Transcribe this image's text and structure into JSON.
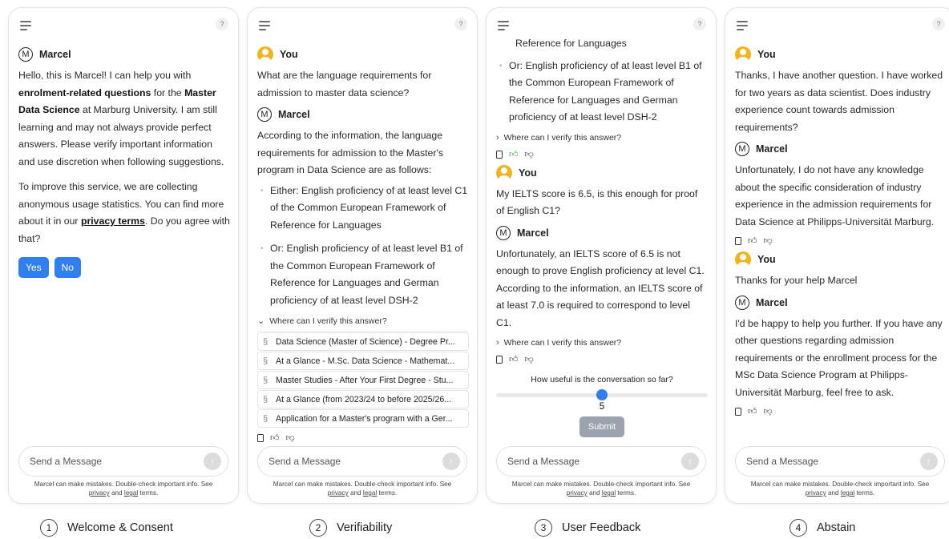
{
  "help_label": "?",
  "input_placeholder": "Send a Message",
  "disclaimer": {
    "text": "Marcel can make mistakes. Double-check important info. See",
    "privacy": "privacy",
    "and": "and",
    "legal": "legal",
    "terms": "terms."
  },
  "names": {
    "bot": "Marcel",
    "user": "You"
  },
  "icons": {
    "menu": "hamburger-icon",
    "send": "arrow-up-icon",
    "copy": "clipboard-icon",
    "like": "thumbs-up-icon",
    "dislike": "thumbs-down-icon",
    "source": "document-icon"
  },
  "colors": {
    "accent": "#2f7ff0",
    "user_avatar": "#f2b31c",
    "like_active": "#22a045",
    "submit_disabled": "#9ba3ae"
  },
  "verify_label": "Where can I verify this answer?",
  "panel1": {
    "msg1_a": "Hello, this is Marcel! I can help you with ",
    "msg1_b": "enrolment-related questions",
    "msg1_c": " for the ",
    "msg1_d": "Master Data Science",
    "msg1_e": " at Marburg University. I am still learning and may not always provide perfect answers. Please verify important information and use discretion when following suggestions.",
    "msg2_a": "To improve this service, we are collecting anonymous usage statistics. You can find more about it in our ",
    "msg2_link": "privacy terms",
    "msg2_b": ". Do you agree with that?",
    "yes": "Yes",
    "no": "No"
  },
  "panel2": {
    "question": "What are the language requirements for admission to master data science?",
    "answer": "According to the information, the language requirements for admission to the Master's program in Data Science are as follows:",
    "bullets": [
      "Either: English proficiency of at least level C1 of the Common European Framework of Reference for Languages",
      "Or: English proficiency of at least level B1 of the Common European Framework of Reference for Languages and German proficiency of at least level DSH-2"
    ],
    "sources": [
      "Data Science (Master of Science) - Degree Pr...",
      "At a Glance - M.Sc. Data Science - Mathemat...",
      "Master Studies - After Your First Degree - Stu...",
      "At a Glance (from 2023/24 to before 2025/26...",
      "Application for a Master's program with a Ger..."
    ]
  },
  "panel3": {
    "bullet_tail": "Reference for Languages",
    "bullet2": "Or: English proficiency of at least level B1 of the Common European Framework of Reference for Languages and German proficiency of at least level DSH-2",
    "question": "My IELTS score is 6.5, is this enough for proof of English C1?",
    "answer": "Unfortunately, an IELTS score of 6.5 is not enough to prove English proficiency at level C1. According to the information, an IELTS score of at least 7.0 is required to correspond to level C1.",
    "feedback_question": "How useful is the conversation so far?",
    "feedback_value": "5",
    "feedback_fraction": 0.5,
    "submit": "Submit"
  },
  "panel4": {
    "q1": "Thanks, I have another question. I have worked for two years as data scientist. Does industry experience count towards admission requirements?",
    "a1": "Unfortunately, I do not have any knowledge about the specific consideration of industry experience in the admission requirements for Data Science at Philipps-Universität Marburg.",
    "q2": "Thanks for your help Marcel",
    "a2": "I'd be happy to help you further. If you have any other questions regarding admission requirements or the enrollment process for the MSc Data Science Program at Philipps-Universität Marburg, feel free to ask."
  },
  "captions": [
    {
      "num": "1",
      "label": "Welcome & Consent"
    },
    {
      "num": "2",
      "label": "Verifiability"
    },
    {
      "num": "3",
      "label": "User Feedback"
    },
    {
      "num": "4",
      "label": "Abstain"
    }
  ]
}
